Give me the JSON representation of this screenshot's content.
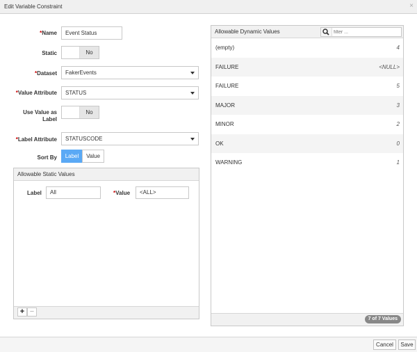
{
  "window": {
    "title": "Edit Variable Constraint",
    "close_glyph": "×"
  },
  "form": {
    "name": {
      "label": "Name",
      "required_mark": "*",
      "value": "Event Status"
    },
    "static": {
      "label": "Static",
      "toggle": "No"
    },
    "dataset": {
      "label": "Dataset",
      "required_mark": "*",
      "value": "FakerEvents"
    },
    "value_attribute": {
      "label": "Value Attribute",
      "required_mark": "*",
      "value": "STATUS"
    },
    "use_value_as_label": {
      "label_line1": "Use Value as",
      "label_line2": "Label",
      "toggle": "No"
    },
    "label_attribute": {
      "label": "Label Attribute",
      "required_mark": "*",
      "value": "STATUSCODE"
    },
    "sort_by": {
      "label": "Sort By",
      "options": [
        "Label",
        "Value"
      ],
      "selected": "Label"
    }
  },
  "static_values": {
    "header": "Allowable Static Values",
    "label_label": "Label",
    "label_value": "All",
    "value_label": "Value",
    "value_required_mark": "*",
    "value_value": "<ALL>",
    "add_glyph": "+",
    "remove_glyph": "−"
  },
  "dynamic_values": {
    "header": "Allowable Dynamic Values",
    "filter_placeholder": "filter ...",
    "rows": [
      {
        "label": "(empty)",
        "count": "4"
      },
      {
        "label": "FAILURE",
        "count": "<NULL>"
      },
      {
        "label": "FAILURE",
        "count": "5"
      },
      {
        "label": "MAJOR",
        "count": "3"
      },
      {
        "label": "MINOR",
        "count": "2"
      },
      {
        "label": "OK",
        "count": "0"
      },
      {
        "label": "WARNING",
        "count": "1"
      }
    ],
    "badge": "7 of 7 Values"
  },
  "footer": {
    "cancel": "Cancel",
    "save": "Save"
  },
  "colors": {
    "accent": "#5aa9f5",
    "required": "#cc0000"
  }
}
